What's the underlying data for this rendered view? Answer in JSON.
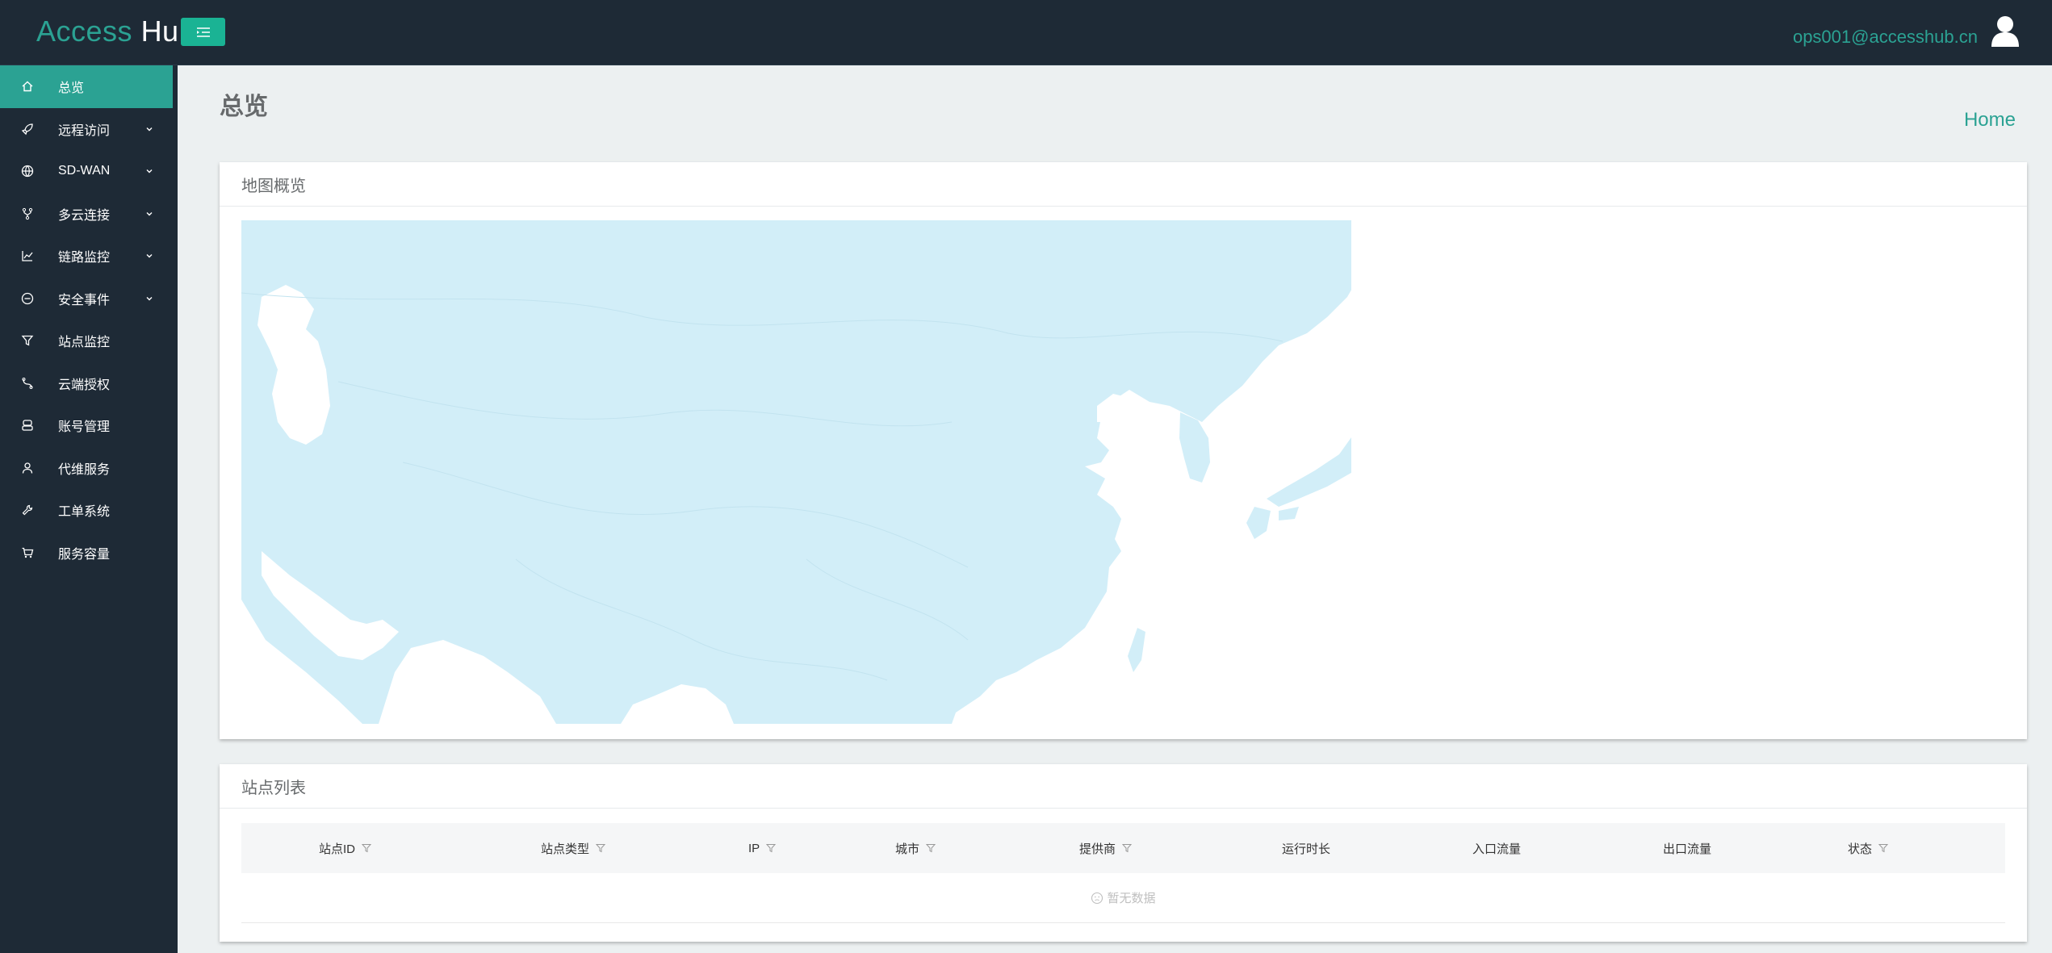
{
  "header": {
    "brand_prefix": "Access",
    "brand_suffix": "Hub",
    "user_email": "ops001@accesshub.cn"
  },
  "sidebar": {
    "items": [
      {
        "label": "总览",
        "icon": "home-icon",
        "active": true,
        "expandable": false
      },
      {
        "label": "远程访问",
        "icon": "rocket-icon",
        "active": false,
        "expandable": true
      },
      {
        "label": "SD-WAN",
        "icon": "globe-icon",
        "active": false,
        "expandable": true
      },
      {
        "label": "多云连接",
        "icon": "fork-icon",
        "active": false,
        "expandable": true
      },
      {
        "label": "链路监控",
        "icon": "line-chart-icon",
        "active": false,
        "expandable": true
      },
      {
        "label": "安全事件",
        "icon": "minus-circle-icon",
        "active": false,
        "expandable": true
      },
      {
        "label": "站点监控",
        "icon": "filter-icon",
        "active": false,
        "expandable": false
      },
      {
        "label": "云端授权",
        "icon": "link-icon",
        "active": false,
        "expandable": false
      },
      {
        "label": "账号管理",
        "icon": "users-icon",
        "active": false,
        "expandable": false
      },
      {
        "label": "代维服务",
        "icon": "user-icon",
        "active": false,
        "expandable": false
      },
      {
        "label": "工单系统",
        "icon": "wrench-icon",
        "active": false,
        "expandable": false
      },
      {
        "label": "服务容量",
        "icon": "cart-icon",
        "active": false,
        "expandable": false
      }
    ]
  },
  "page": {
    "title": "总览",
    "breadcrumb": "Home"
  },
  "map_panel": {
    "title": "地图概览"
  },
  "sites_panel": {
    "title": "站点列表",
    "columns": [
      {
        "label": "站点ID",
        "filterable": true
      },
      {
        "label": "站点类型",
        "filterable": true
      },
      {
        "label": "IP",
        "filterable": true
      },
      {
        "label": "城市",
        "filterable": true
      },
      {
        "label": "提供商",
        "filterable": true
      },
      {
        "label": "运行时长",
        "filterable": false
      },
      {
        "label": "入口流量",
        "filterable": false
      },
      {
        "label": "出口流量",
        "filterable": false
      },
      {
        "label": "状态",
        "filterable": true
      }
    ],
    "empty_text": "暂无数据"
  },
  "colors": {
    "accent": "#2ba293",
    "sidebar_bg": "#1e2a36",
    "map_land": "#d2eef8"
  }
}
